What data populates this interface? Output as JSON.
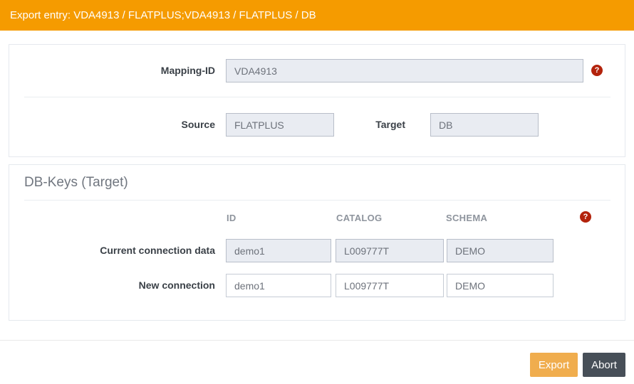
{
  "header": {
    "title": "Export entry: VDA4913 / FLATPLUS;VDA4913 / FLATPLUS / DB"
  },
  "colors": {
    "accent": "#f59b00",
    "export_button": "#f0ad4e",
    "abort_button": "#474f58",
    "help_icon": "#b3230c",
    "readonly_bg": "#e9ecf2"
  },
  "icons": {
    "help": "question-circle-icon",
    "help_glyph": "?"
  },
  "mapping_panel": {
    "mapping_id": {
      "label": "Mapping-ID",
      "value": "VDA4913"
    },
    "source": {
      "label": "Source",
      "value": "FLATPLUS"
    },
    "target": {
      "label": "Target",
      "value": "DB"
    }
  },
  "db_keys_panel": {
    "title": "DB-Keys (Target)",
    "columns": [
      "ID",
      "CATALOG",
      "SCHEMA"
    ],
    "rows": [
      {
        "label": "Current connection data",
        "readonly": true,
        "values": [
          "demo1",
          "L009777T",
          "DEMO"
        ]
      },
      {
        "label": "New connection",
        "readonly": false,
        "values": [
          "demo1",
          "L009777T",
          "DEMO"
        ]
      }
    ]
  },
  "footer": {
    "export_label": "Export",
    "abort_label": "Abort"
  }
}
